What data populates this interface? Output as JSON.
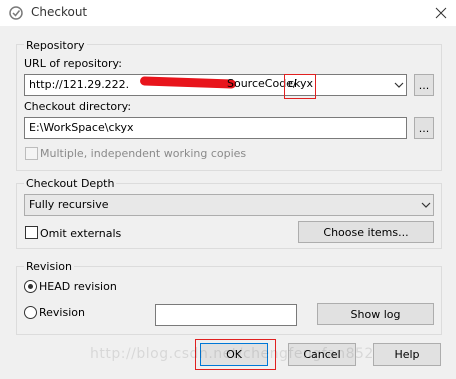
{
  "window": {
    "title": "Checkout",
    "icon": "svn-checkout-icon"
  },
  "repository": {
    "group_label": "Repository",
    "url_label": "URL of repository:",
    "url_prefix": "http://121.29.222.",
    "url_suffix": "SourceCode/",
    "url_highlight": "ckyx",
    "browse_label": "...",
    "checkout_dir_label": "Checkout directory:",
    "checkout_dir_value": "E:\\WorkSpace\\ckyx",
    "dir_browse_label": "...",
    "multiple_wc_label": "Multiple, independent working copies",
    "multiple_wc_checked": false
  },
  "depth": {
    "group_label": "Checkout Depth",
    "selected": "Fully recursive",
    "omit_externals_label": "Omit externals",
    "omit_externals_checked": false,
    "choose_items_label": "Choose items..."
  },
  "revision": {
    "group_label": "Revision",
    "head_label": "HEAD revision",
    "revision_label": "Revision",
    "revision_value": "",
    "selected": "HEAD revision",
    "show_log_label": "Show log"
  },
  "buttons": {
    "ok": "OK",
    "cancel": "Cancel",
    "help": "Help"
  },
  "watermark": "http://blog.csdn.net/chengfengfan852",
  "colors": {
    "highlight_box": "#e02020",
    "redaction": "#e8141b",
    "ok_border": "#0078d7"
  }
}
